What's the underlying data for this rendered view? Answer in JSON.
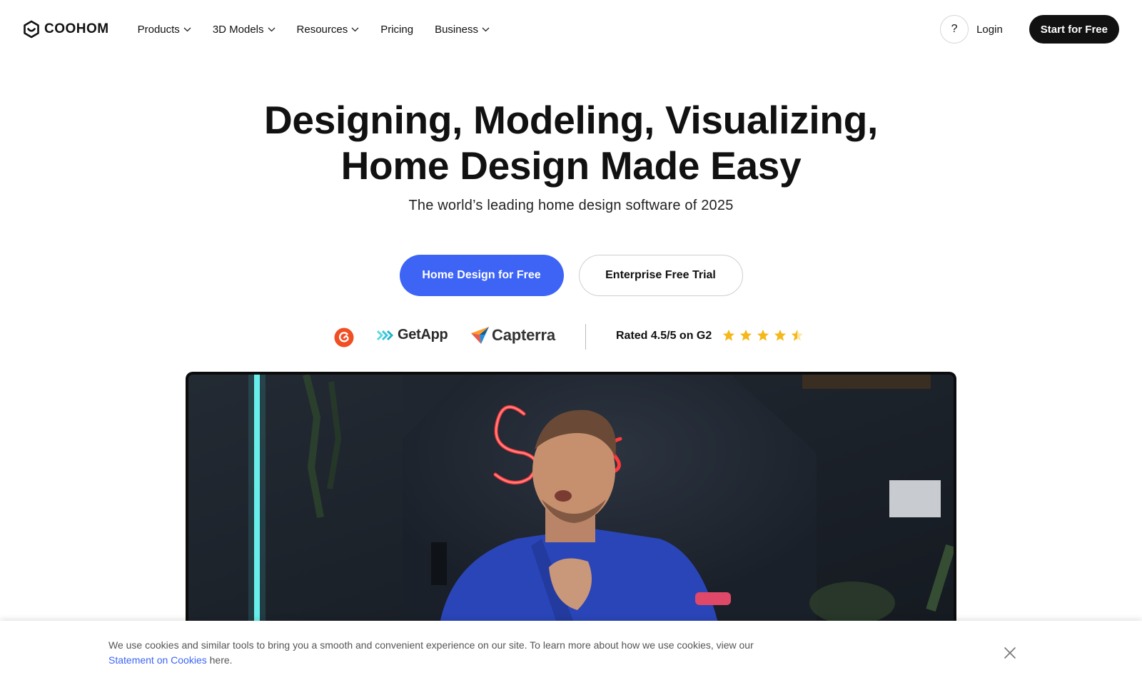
{
  "header": {
    "logo_text": "COOHOM",
    "nav": [
      {
        "label": "Products",
        "has_dropdown": true
      },
      {
        "label": "3D Models",
        "has_dropdown": true
      },
      {
        "label": "Resources",
        "has_dropdown": true
      },
      {
        "label": "Pricing",
        "has_dropdown": false
      },
      {
        "label": "Business",
        "has_dropdown": true
      }
    ],
    "help_label": "?",
    "login_label": "Login",
    "start_label": "Start for Free"
  },
  "hero": {
    "title_line1": "Designing, Modeling, Visualizing,",
    "title_line2": "Home Design Made Easy",
    "subtitle": "The world’s leading home design software of 2025",
    "cta_primary": "Home Design for Free",
    "cta_secondary": "Enterprise Free Trial"
  },
  "ratings": {
    "g2_icon": "g2-icon",
    "getapp_text": "GetApp",
    "capterra_text": "Capterra",
    "rated_text": "Rated 4.5/5 on G2",
    "rating_value": 4.5,
    "rating_max": 5
  },
  "video": {
    "neon_text": "S",
    "icon": "video-player"
  },
  "cookie": {
    "text_before": "We use cookies and similar tools to bring you a smooth and convenient experience on our site. To learn more about how we use cookies, view our ",
    "link_text": "Statement on Cookies",
    "text_after": " here.",
    "close_icon": "close-icon"
  },
  "colors": {
    "primary": "#3d64f5",
    "dark": "#111111",
    "star": "#f5b81c",
    "g2": "#f04e23"
  }
}
